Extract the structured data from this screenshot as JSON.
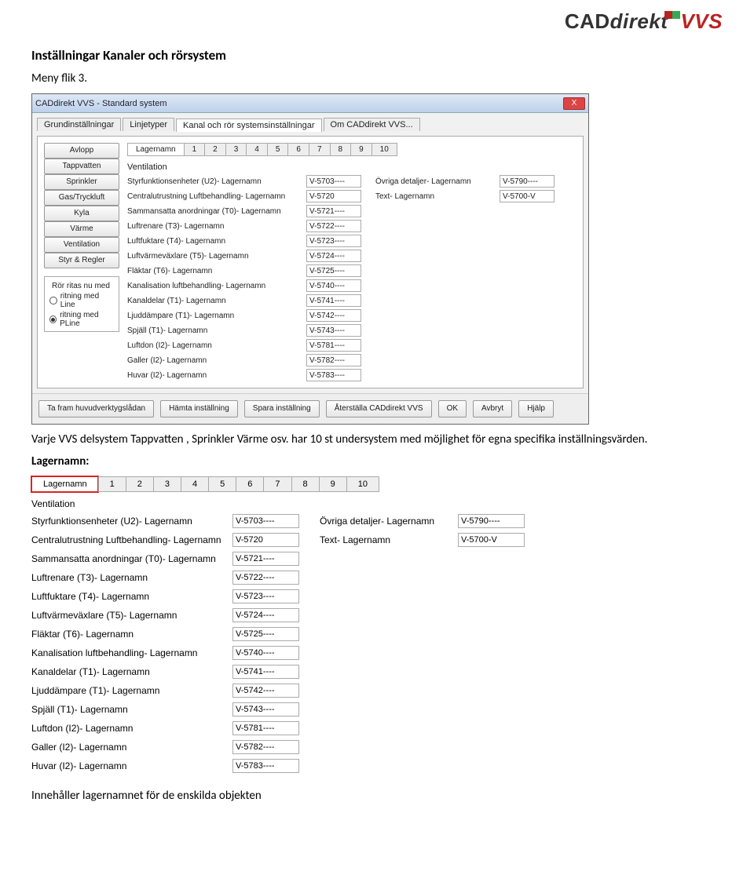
{
  "logo": {
    "cad": "CAD",
    "direkt": "direkt",
    "vvs": "VVS"
  },
  "doc": {
    "heading": "Inställningar Kanaler och rörsystem",
    "menyflik": "Meny flik 3.",
    "para1": "Varje VVS delsystem Tappvatten , Sprinkler Värme osv. har 10 st undersystem med möjlighet för egna specifika inställningsvärden.",
    "lagernamn_h": "Lagernamn:",
    "footer": "Innehåller lagernamnet för de enskilda objekten"
  },
  "dialog": {
    "title": "CADdirekt VVS - Standard system",
    "close": "X",
    "tabs_outer": [
      "Grundinställningar",
      "Linjetyper",
      "Kanal och rör systemsinställningar",
      "Om CADdirekt VVS..."
    ],
    "tabs_outer_active": 2,
    "side_buttons": [
      "Avlopp",
      "Tappvatten",
      "Sprinkler",
      "Gas/Tryckluft",
      "Kyla",
      "Värme",
      "Ventilation",
      "Styr & Regler"
    ],
    "group_title": "Rör ritas nu med",
    "radios": [
      {
        "label": "ritning med Line",
        "checked": false
      },
      {
        "label": "ritning med PLine",
        "checked": true
      }
    ],
    "subtabs": [
      "Lagernamn",
      "1",
      "2",
      "3",
      "4",
      "5",
      "6",
      "7",
      "8",
      "9",
      "10"
    ],
    "subtabs_active": 0,
    "section": "Ventilation",
    "rows_left": [
      {
        "label": "Styrfunktionsenheter (U2)- Lagernamn",
        "value": "V-5703----"
      },
      {
        "label": "Centralutrustning Luftbehandling- Lagernamn",
        "value": "V-5720"
      },
      {
        "label": "Sammansatta anordningar (T0)- Lagernamn",
        "value": "V-5721----"
      },
      {
        "label": "Luftrenare (T3)- Lagernamn",
        "value": "V-5722----"
      },
      {
        "label": "Luftfuktare (T4)- Lagernamn",
        "value": "V-5723----"
      },
      {
        "label": "Luftvärmeväxlare (T5)- Lagernamn",
        "value": "V-5724----"
      },
      {
        "label": "Fläktar (T6)- Lagernamn",
        "value": "V-5725----"
      },
      {
        "label": "Kanalisation luftbehandling- Lagernamn",
        "value": "V-5740----"
      },
      {
        "label": "Kanaldelar (T1)- Lagernamn",
        "value": "V-5741----"
      },
      {
        "label": "Ljuddämpare (T1)- Lagernamn",
        "value": "V-5742----"
      },
      {
        "label": "Spjäll (T1)- Lagernamn",
        "value": "V-5743----"
      },
      {
        "label": "Luftdon (I2)- Lagernamn",
        "value": "V-5781----"
      },
      {
        "label": "Galler (I2)- Lagernamn",
        "value": "V-5782----"
      },
      {
        "label": "Huvar (I2)- Lagernamn",
        "value": "V-5783----"
      }
    ],
    "rows_right": [
      {
        "label": "Övriga detaljer- Lagernamn",
        "value": "V-5790----"
      },
      {
        "label": "Text- Lagernamn",
        "value": "V-5700-V"
      }
    ],
    "bottom_buttons": [
      "Ta fram huvudverktygslådan",
      "Hämta inställning",
      "Spara inställning",
      "Återställa CADdirekt VVS",
      "OK",
      "Avbryt",
      "Hjälp"
    ]
  },
  "detail": {
    "subtabs": [
      "Lagernamn",
      "1",
      "2",
      "3",
      "4",
      "5",
      "6",
      "7",
      "8",
      "9",
      "10"
    ],
    "subtabs_highlight": 0,
    "section": "Ventilation",
    "rows_left": [
      {
        "label": "Styrfunktionsenheter (U2)- Lagernamn",
        "value": "V-5703----"
      },
      {
        "label": "Centralutrustning Luftbehandling- Lagernamn",
        "value": "V-5720"
      },
      {
        "label": "Sammansatta anordningar (T0)- Lagernamn",
        "value": "V-5721----"
      },
      {
        "label": "Luftrenare (T3)- Lagernamn",
        "value": "V-5722----"
      },
      {
        "label": "Luftfuktare (T4)- Lagernamn",
        "value": "V-5723----"
      },
      {
        "label": "Luftvärmeväxlare (T5)- Lagernamn",
        "value": "V-5724----"
      },
      {
        "label": "Fläktar (T6)- Lagernamn",
        "value": "V-5725----"
      },
      {
        "label": "Kanalisation luftbehandling- Lagernamn",
        "value": "V-5740----"
      },
      {
        "label": "Kanaldelar (T1)- Lagernamn",
        "value": "V-5741----"
      },
      {
        "label": "Ljuddämpare (T1)- Lagernamn",
        "value": "V-5742----"
      },
      {
        "label": "Spjäll (T1)- Lagernamn",
        "value": "V-5743----"
      },
      {
        "label": "Luftdon (I2)- Lagernamn",
        "value": "V-5781----"
      },
      {
        "label": "Galler (I2)- Lagernamn",
        "value": "V-5782----"
      },
      {
        "label": "Huvar (I2)- Lagernamn",
        "value": "V-5783----"
      }
    ],
    "rows_right": [
      {
        "label": "Övriga detaljer- Lagernamn",
        "value": "V-5790----"
      },
      {
        "label": "Text- Lagernamn",
        "value": "V-5700-V"
      }
    ]
  }
}
